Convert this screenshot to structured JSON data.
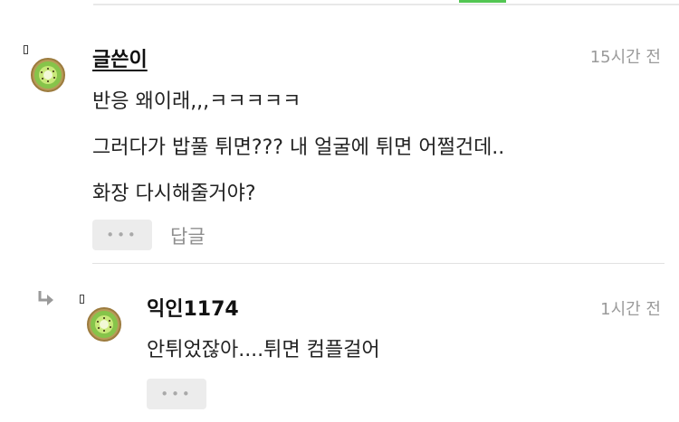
{
  "comment": {
    "author": "글쓴이",
    "time": "15시간 전",
    "lines": [
      "반응 왜이래,,,ㅋㅋㅋㅋㅋ",
      "그러다가 밥풀 튀면??? 내 얼굴에 튀면 어쩔건데..",
      "화장 다시해줄거야?"
    ],
    "more_label": "•••",
    "reply_label": "답글"
  },
  "reply": {
    "author": "익인1174",
    "time": "1시간 전",
    "lines": [
      "안튀었잖아....튀면 컴플걸어"
    ],
    "more_label": "•••"
  },
  "icons": {
    "avatar": "kiwi-avatar-icon",
    "reply_arrow": "reply-arrow-icon"
  },
  "colors": {
    "accent": "#53c653",
    "muted_text": "#9a9a9a",
    "button_bg": "#ececec"
  }
}
